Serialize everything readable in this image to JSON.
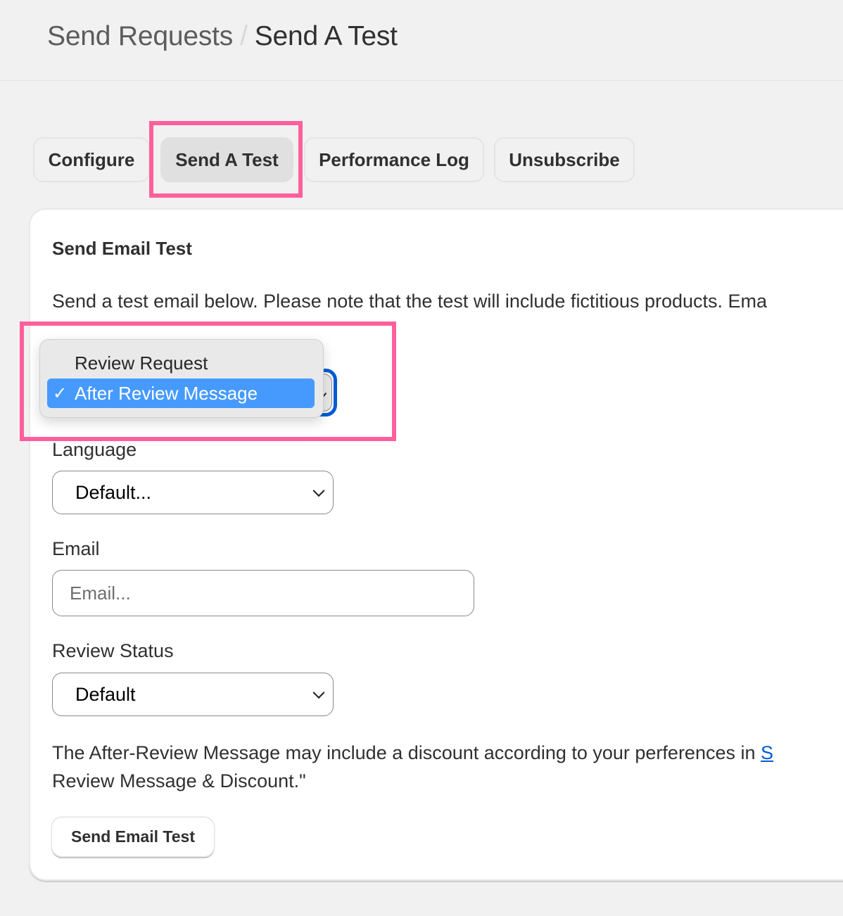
{
  "breadcrumb": {
    "parent": "Send Requests",
    "separator": "/",
    "current": "Send A Test"
  },
  "tabs": [
    {
      "label": "Configure",
      "active": false
    },
    {
      "label": "Send A Test",
      "active": true
    },
    {
      "label": "Performance Log",
      "active": false
    },
    {
      "label": "Unsubscribe",
      "active": false
    }
  ],
  "card": {
    "title": "Send Email Test",
    "description": "Send a test email below. Please note that the test will include fictitious products. Ema"
  },
  "type_select": {
    "selected": "After Review Message",
    "options": [
      {
        "label": "Review Request",
        "selected": false
      },
      {
        "label": "After Review Message",
        "selected": true
      }
    ],
    "check_glyph": "✓"
  },
  "language": {
    "label": "Language",
    "value": "Default..."
  },
  "email": {
    "label": "Email",
    "value": "",
    "placeholder": "Email..."
  },
  "review_status": {
    "label": "Review Status",
    "value": "Default"
  },
  "note": {
    "text_before_link": "The After-Review Message may include a discount according to your perferences in ",
    "link_text": "S",
    "text_after_link": "Review Message & Discount.\""
  },
  "send_button": {
    "label": "Send Email Test"
  },
  "colors": {
    "highlight": "#fe5f9c",
    "focus_ring": "#005bd3",
    "selected_option": "#469afe",
    "link": "#005bd3"
  }
}
